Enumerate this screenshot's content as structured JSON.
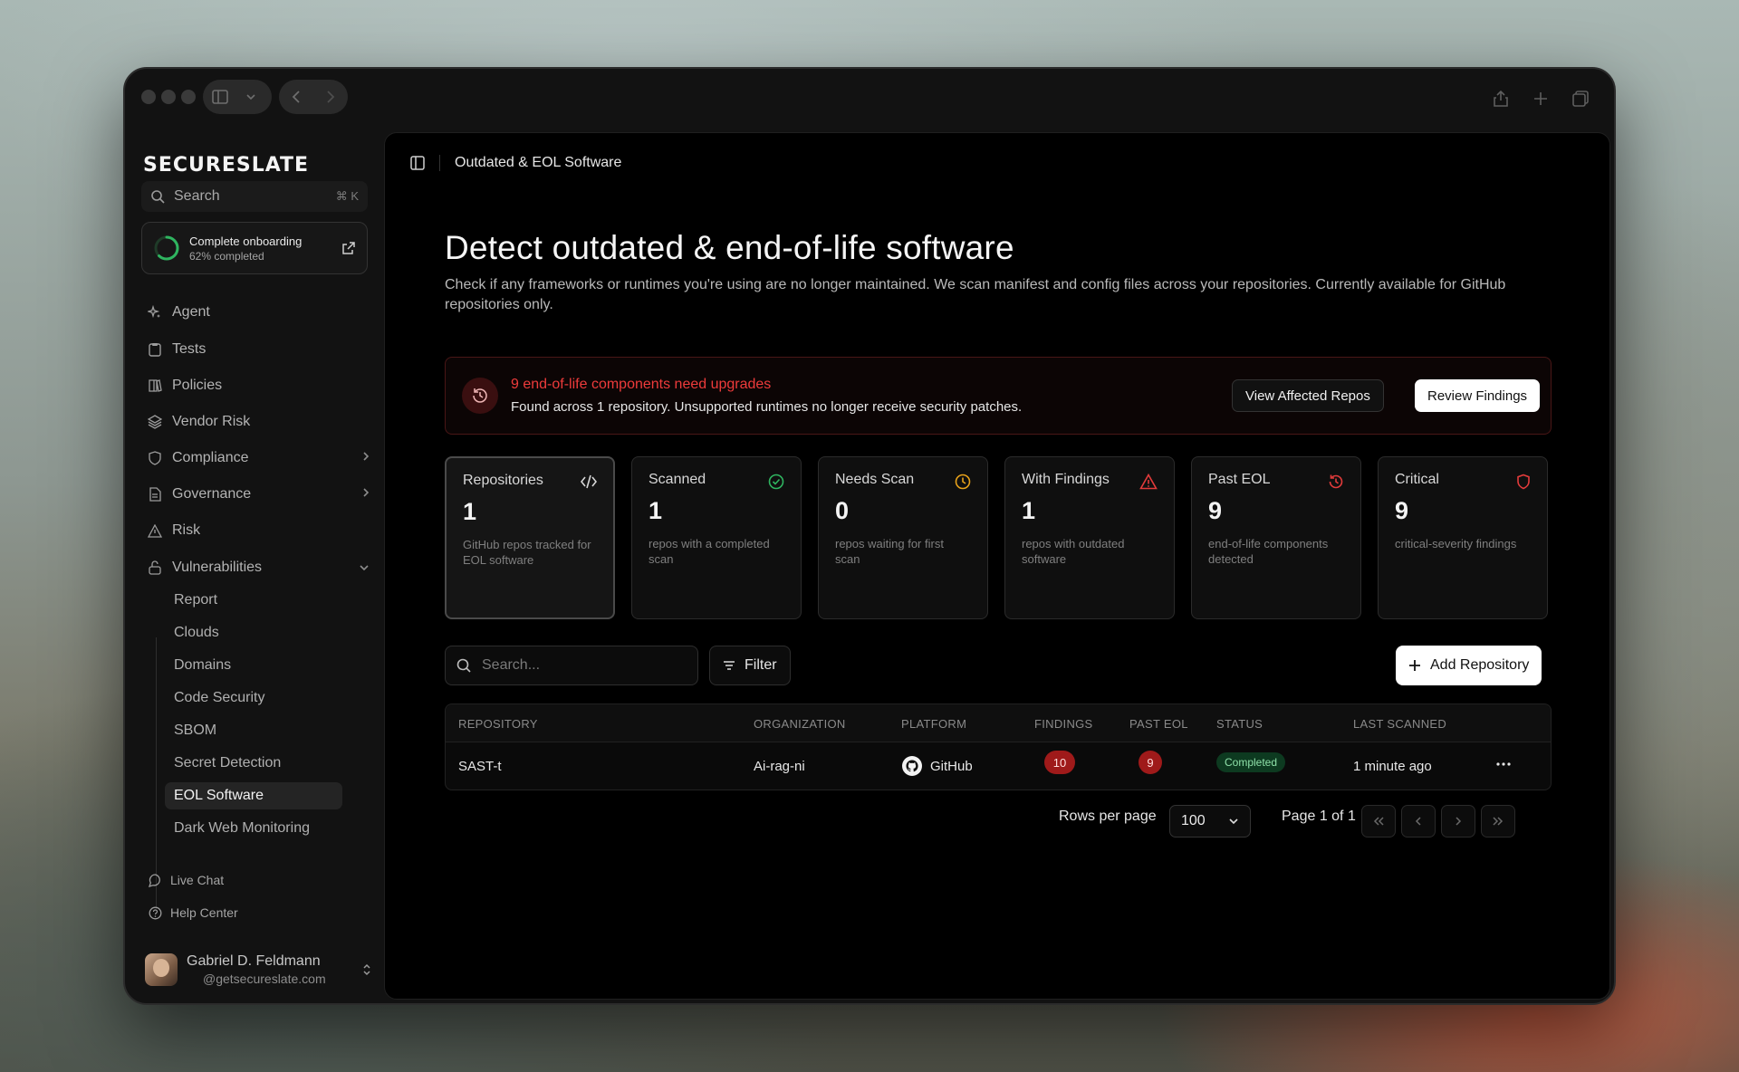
{
  "app": {
    "brand": "SECURESLATE",
    "search_placeholder": "Search",
    "search_shortcut": "⌘ K"
  },
  "onboarding": {
    "title": "Complete onboarding",
    "subtitle": "62% completed",
    "progress": 0.62
  },
  "nav": {
    "agent": "Agent",
    "tests": "Tests",
    "policies": "Policies",
    "vendor_risk": "Vendor Risk",
    "compliance": "Compliance",
    "governance": "Governance",
    "risk": "Risk",
    "vulnerabilities": "Vulnerabilities",
    "sub": [
      "Report",
      "Clouds",
      "Domains",
      "Code Security",
      "SBOM",
      "Secret Detection",
      "EOL Software",
      "Dark Web Monitoring"
    ],
    "live_chat": "Live Chat",
    "help_center": "Help Center"
  },
  "user": {
    "name": "Gabriel D. Feldmann",
    "email": "@getsecureslate.com"
  },
  "page": {
    "breadcrumb": "Outdated & EOL Software",
    "title": "Detect outdated & end-of-life software",
    "description": "Check if any frameworks or runtimes you're using are no longer maintained. We scan manifest and config files across your repositories. Currently available for GitHub repositories only."
  },
  "alert": {
    "title": "9 end-of-life components need upgrades",
    "subtitle": "Found across 1 repository. Unsupported runtimes no longer receive security patches.",
    "btn_view": "View Affected Repos",
    "btn_review": "Review Findings"
  },
  "stats": [
    {
      "label": "Repositories",
      "value": "1",
      "desc": "GitHub repos tracked for EOL software",
      "icon": "code-icon",
      "color": "#d8d8d8"
    },
    {
      "label": "Scanned",
      "value": "1",
      "desc": "repos with a completed scan",
      "icon": "check-circle-icon",
      "color": "#2fb560"
    },
    {
      "label": "Needs Scan",
      "value": "0",
      "desc": "repos waiting for first scan",
      "icon": "clock-icon",
      "color": "#e8a21a"
    },
    {
      "label": "With Findings",
      "value": "1",
      "desc": "repos with outdated software",
      "icon": "warning-triangle-icon",
      "color": "#e23b3b"
    },
    {
      "label": "Past EOL",
      "value": "9",
      "desc": "end-of-life components detected",
      "icon": "history-clock-icon",
      "color": "#e23b3b"
    },
    {
      "label": "Critical",
      "value": "9",
      "desc": "critical-severity findings",
      "icon": "shield-icon",
      "color": "#e23b3b"
    }
  ],
  "toolbar": {
    "search_placeholder": "Search...",
    "filter": "Filter",
    "add_repo": "Add Repository"
  },
  "table": {
    "headers": [
      "REPOSITORY",
      "ORGANIZATION",
      "PLATFORM",
      "FINDINGS",
      "PAST EOL",
      "STATUS",
      "LAST SCANNED"
    ],
    "rows": [
      {
        "repository": "SAST-t",
        "organization": "Ai-rag-ni",
        "platform": "GitHub",
        "findings": "10",
        "past_eol": "9",
        "status": "Completed",
        "last_scanned": "1 minute ago"
      }
    ]
  },
  "pagination": {
    "rows_label": "Rows per page",
    "rows_value": "100",
    "page_label": "Page 1 of 1"
  },
  "colors": {
    "accent_red": "#ee3b3b",
    "success": "#2fb560",
    "warning": "#e8a21a"
  }
}
